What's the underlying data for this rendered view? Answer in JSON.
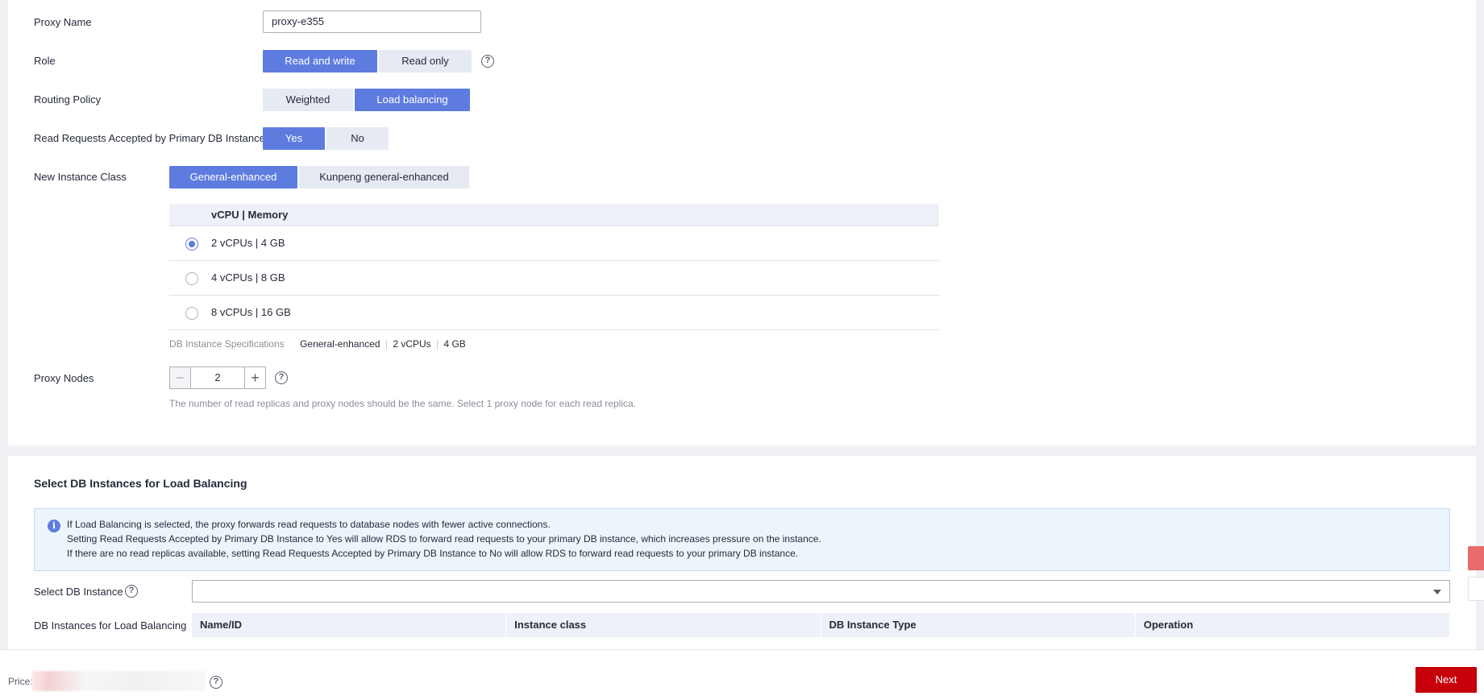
{
  "form": {
    "proxy_name_label": "Proxy Name",
    "proxy_name_value": "proxy-e355",
    "role_label": "Role",
    "role_options": [
      "Read and write",
      "Read only"
    ],
    "role_selected": "Read and write",
    "routing_label": "Routing Policy",
    "routing_options": [
      "Weighted",
      "Load balancing"
    ],
    "routing_selected": "Load balancing",
    "read_primary_label": "Read Requests Accepted by Primary DB Instance",
    "read_primary_options": [
      "Yes",
      "No"
    ],
    "read_primary_selected": "Yes",
    "instance_class_label": "New Instance Class",
    "instance_class_options": [
      "General-enhanced",
      "Kunpeng general-enhanced"
    ],
    "instance_class_selected": "General-enhanced",
    "spec_table": {
      "header": "vCPU | Memory",
      "rows": [
        "2 vCPUs | 4 GB",
        "4 vCPUs | 8 GB",
        "8 vCPUs | 16 GB"
      ],
      "selected_index": 0
    },
    "db_spec": {
      "label": "DB Instance Specifications",
      "class": "General-enhanced",
      "vcpus": "2 vCPUs",
      "memory": "4 GB"
    },
    "proxy_nodes_label": "Proxy Nodes",
    "proxy_nodes_value": "2",
    "proxy_nodes_hint": "The number of read replicas and proxy nodes should be the same. Select 1 proxy node for each read replica."
  },
  "lb_section": {
    "title": "Select DB Instances for Load Balancing",
    "info_lines": [
      "If Load Balancing is selected, the proxy forwards read requests to database nodes with fewer active connections.",
      "Setting Read Requests Accepted by Primary DB Instance to Yes will allow RDS to forward read requests to your primary DB instance, which increases pressure on the instance.",
      "If there are no read replicas available, setting Read Requests Accepted by Primary DB Instance to No will allow RDS to forward read requests to your primary DB instance."
    ],
    "select_label": "Select DB Instance",
    "select_value": "",
    "table_label": "DB Instances for Load Balancing",
    "table_columns": [
      "Name/ID",
      "Instance class",
      "DB Instance Type",
      "Operation"
    ]
  },
  "footer": {
    "price_label": "Price:",
    "next_label": "Next"
  },
  "colors": {
    "primary": "#5e7ce0",
    "segment_off": "#e6eaf3",
    "next_button": "#c7000b"
  }
}
